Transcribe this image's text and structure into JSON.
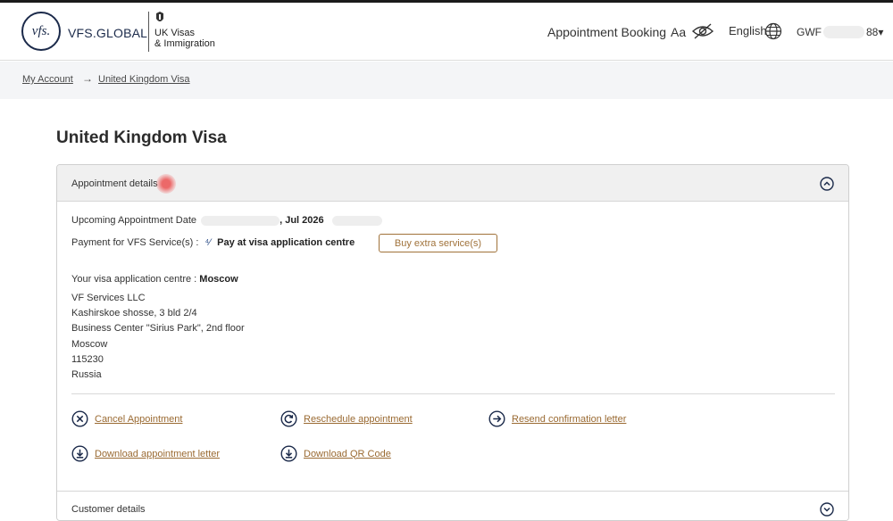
{
  "header": {
    "logo_text": "VFS.GLOBAL",
    "logo_mark": "vfs.",
    "partner_line1": "UK Visas",
    "partner_line2": "& Immigration",
    "nav_booking": "Appointment Booking",
    "nav_font_size": "Aa",
    "nav_language": "English",
    "user_prefix": "GWF",
    "user_suffix": "88",
    "user_caret": "▾"
  },
  "breadcrumb": {
    "items": [
      "My Account",
      "United Kingdom Visa"
    ],
    "separator": "→"
  },
  "page": {
    "title": "United Kingdom Visa"
  },
  "appointment": {
    "section_label": "Appointment details",
    "date_label": "Upcoming Appointment Date",
    "date_value": ", Jul 2026",
    "payment_label": "Payment for VFS Service(s) :",
    "payment_value": "Pay at visa application centre",
    "buy_button": "Buy extra service(s)",
    "centre_label": "Your visa application centre :",
    "centre_value": "Moscow",
    "address_lines": [
      "VF Services LLC",
      "Kashirskoe shosse, 3 bld 2/4",
      "Business Center \"Sirius Park\", 2nd floor",
      "Moscow",
      "115230",
      "Russia"
    ],
    "actions": [
      {
        "label": "Cancel Appointment",
        "icon": "cancel-circle-icon"
      },
      {
        "label": "Reschedule appointment",
        "icon": "reschedule-circle-icon"
      },
      {
        "label": "Resend confirmation letter",
        "icon": "arrow-right-circle-icon"
      },
      {
        "label": "Download appointment letter",
        "icon": "download-circle-icon"
      },
      {
        "label": "Download QR Code",
        "icon": "download-circle-icon"
      }
    ]
  },
  "customer": {
    "section_label": "Customer details"
  },
  "colors": {
    "brand_navy": "#1b2a4a",
    "link_brown": "#9a6a32",
    "crumb_bg": "#f4f5f7",
    "section_head_bg": "#f0f0f0"
  }
}
